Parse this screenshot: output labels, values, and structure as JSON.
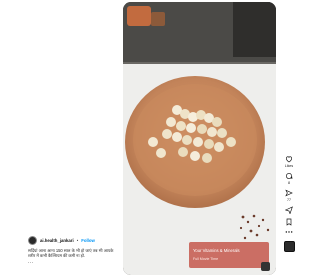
{
  "post": {
    "username": "ai.health_jankari",
    "separator": "•",
    "follow_label": "Follow",
    "caption": "सर्दियां आना आना 150 साल के भी हो जाएं तब भी आपके शरीर में कभी कैल्शियम की कमी ना हो.",
    "more": "..."
  },
  "video": {
    "overlay_text": "Your Vitamins & Minerals",
    "overlay_subtext": "Full Movie Time",
    "snacks_caption": "makhana / fox nuts in clay bowl"
  },
  "actions": {
    "likes": "Likes",
    "comments": "8",
    "shares": "77",
    "save": ""
  },
  "colors": {
    "follow": "#0095f6",
    "bowl": "#c98a5d",
    "table": "#f2f2f0"
  }
}
